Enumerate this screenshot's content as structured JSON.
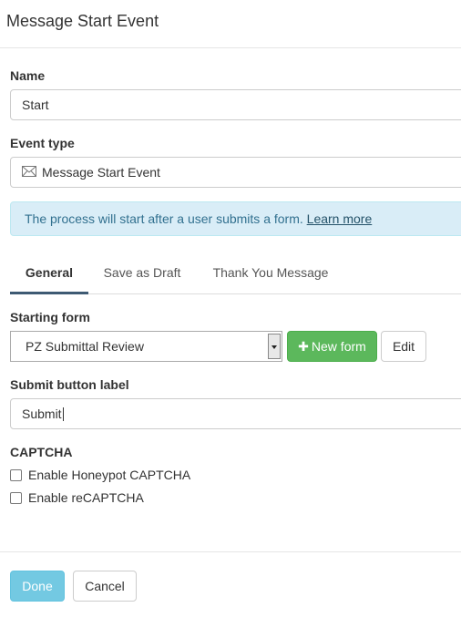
{
  "dialog": {
    "title": "Message Start Event"
  },
  "name": {
    "label": "Name",
    "value": "Start"
  },
  "event_type": {
    "label": "Event type",
    "icon": "envelope-icon",
    "value": "Message Start Event"
  },
  "info": {
    "text": "The process will start after a user submits a form.",
    "link": "Learn more",
    "bg_color": "#d9edf7"
  },
  "tabs": [
    {
      "label": "General",
      "active": true
    },
    {
      "label": "Save as Draft",
      "active": false
    },
    {
      "label": "Thank You Message",
      "active": false
    }
  ],
  "starting_form": {
    "label": "Starting form",
    "selected": "PZ Submittal Review",
    "new_form_label": "New form",
    "edit_label": "Edit"
  },
  "submit_label": {
    "label": "Submit button label",
    "value": "Submit"
  },
  "captcha": {
    "heading": "CAPTCHA",
    "options": [
      {
        "label": "Enable Honeypot CAPTCHA",
        "checked": false
      },
      {
        "label": "Enable reCAPTCHA",
        "checked": false
      }
    ]
  },
  "footer": {
    "done_label": "Done",
    "cancel_label": "Cancel"
  },
  "colors": {
    "success": "#5cb85c",
    "primary": "#5bc0de",
    "tab_accent": "#3e5a73"
  }
}
